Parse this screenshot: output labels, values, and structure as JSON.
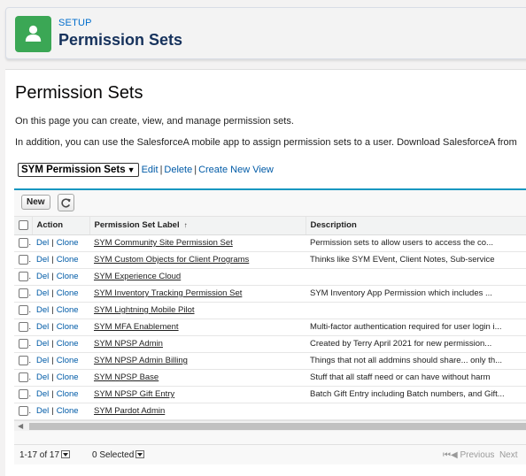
{
  "header": {
    "kicker": "SETUP",
    "title": "Permission Sets",
    "icon": "user-icon",
    "icon_color": "#3ba755"
  },
  "page": {
    "title": "Permission Sets",
    "description_1": "On this page you can create, view, and manage permission sets.",
    "description_2": "In addition, you can use the SalesforceA mobile app to assign permission sets to a user. Download SalesforceA from"
  },
  "view_selector": {
    "selected": "SYM Permission Sets",
    "edit": "Edit",
    "delete": "Delete",
    "create": "Create New View",
    "sep": "|"
  },
  "toolbar": {
    "new_label": "New",
    "refresh_icon": "refresh-icon"
  },
  "table": {
    "columns": [
      "Action",
      "Permission Set Label",
      "Description"
    ],
    "sort_indicator": "↑",
    "action_del": "Del",
    "action_clone": "Clone",
    "action_sep": "|",
    "rows": [
      {
        "label": "SYM Community Site Permission Set",
        "description": "Permission sets to allow users to access the co..."
      },
      {
        "label": "SYM Custom Objects for Client Programs",
        "description": "Thinks like SYM EVent, Client Notes, Sub-service"
      },
      {
        "label": "SYM Experience Cloud",
        "description": ""
      },
      {
        "label": "SYM Inventory Tracking Permission Set",
        "description": "SYM Inventory App Permission which includes ..."
      },
      {
        "label": "SYM Lightning Mobile Pilot",
        "description": ""
      },
      {
        "label": "SYM MFA Enablement",
        "description": "Multi-factor authentication required for user login i..."
      },
      {
        "label": "SYM NPSP Admin",
        "description": "Created by Terry April 2021 for new permission..."
      },
      {
        "label": "SYM NPSP Admin Billing",
        "description": "Things that not all addmins should share... only th..."
      },
      {
        "label": "SYM NPSP Base",
        "description": "Stuff that all staff need or can have without harm"
      },
      {
        "label": "SYM NPSP Gift Entry",
        "description": "Batch Gift Entry including Batch numbers, and Gift..."
      },
      {
        "label": "SYM Pardot Admin",
        "description": ""
      }
    ]
  },
  "footer": {
    "range": "1-17 of 17",
    "selected": "0 Selected",
    "previous": "Previous",
    "next": "Next"
  },
  "colors": {
    "link": "#015ba7",
    "list_accent": "#1797c0",
    "title": "#16325c"
  }
}
